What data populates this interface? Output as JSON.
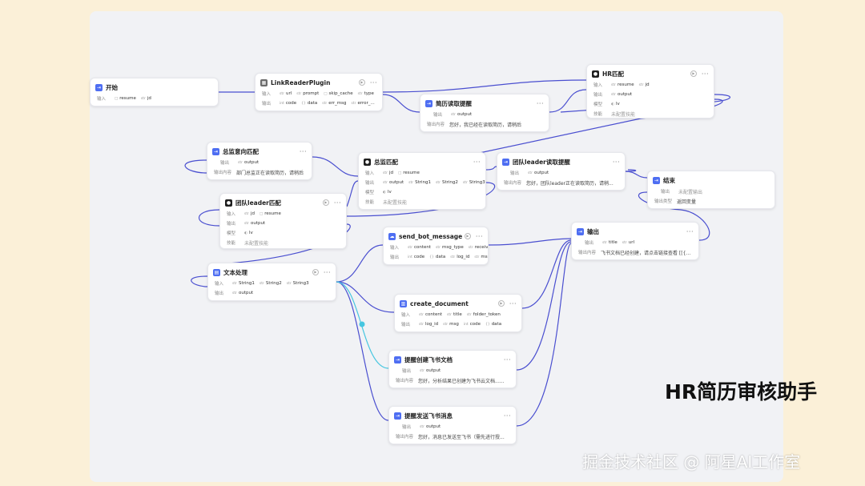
{
  "caption": "HR简历审核助手",
  "watermark": "掘金技术社区 @ 阿星AI工作室",
  "colors": {
    "edge": "#4a4fd0",
    "edge_alt": "#46c6e0",
    "accent": "#4e6ef2"
  },
  "nodes": {
    "start": {
      "title": "开始",
      "in_label": "输入",
      "params": [
        "resume",
        "jd"
      ]
    },
    "link_reader": {
      "title": "LinkReaderPlugin",
      "in_label": "输入",
      "in_params": [
        "url",
        "prompt",
        "skip_cache",
        "type"
      ],
      "out_label": "输出",
      "out_params": [
        "code",
        "data",
        "err_msg",
        "error_..."
      ]
    },
    "resume_reading": {
      "title": "简历读取提醒",
      "out_label": "输出",
      "out_params": [
        "output"
      ],
      "content_label": "输出内容",
      "content": "您好，我已经在读取简历，请稍后"
    },
    "hr_match": {
      "title": "HR匹配",
      "in_label": "输入",
      "in_params": [
        "resume",
        "jd"
      ],
      "out_label": "输出",
      "out_params": [
        "output"
      ],
      "model_label": "模型",
      "model": "lv",
      "skill_label": "技能",
      "skill": "未配置技能"
    },
    "director_intent": {
      "title": "总监意向匹配",
      "out_label": "输出",
      "out_params": [
        "output"
      ],
      "content_label": "输出内容",
      "content": "部门总监正在读取简历，请稍后"
    },
    "director_match": {
      "title": "总监匹配",
      "in_label": "输入",
      "in_params": [
        "jd",
        "resume"
      ],
      "out_label": "输出",
      "out_params": [
        "output",
        "String1",
        "String2",
        "String3"
      ],
      "model_label": "模型",
      "model": "lv",
      "skill_label": "技能",
      "skill": "未配置技能"
    },
    "team_leader_reading": {
      "title": "团队leader读取提醒",
      "out_label": "输出",
      "out_params": [
        "output"
      ],
      "content_label": "输出内容",
      "content": "您好，团队leader正在读取简历，请稍..."
    },
    "end": {
      "title": "结束",
      "out_label": "输出",
      "out_value": "未配置输出",
      "type_label": "输出类型",
      "type_value": "返回变量"
    },
    "team_leader_match": {
      "title": "团队leader匹配",
      "in_label": "输入",
      "in_params": [
        "jd",
        "resume"
      ],
      "out_label": "输出",
      "out_params": [
        "output"
      ],
      "model_label": "模型",
      "model": "lv",
      "skill_label": "技能",
      "skill": "未配置技能"
    },
    "send_bot": {
      "title": "send_bot_message",
      "in_label": "输入",
      "in_params": [
        "content",
        "msg_type",
        "receive_id"
      ],
      "out_label": "输出",
      "out_params": [
        "code",
        "data",
        "log_id",
        "msg"
      ]
    },
    "output": {
      "title": "输出",
      "out_label": "输出",
      "out_params": [
        "title",
        "url"
      ],
      "content_label": "输出内容",
      "content": "飞书文档已经创建，请点击链接查看 [[{h..."
    },
    "text_process": {
      "title": "文本处理",
      "in_label": "输入",
      "in_params": [
        "String1",
        "String2",
        "String3"
      ],
      "out_label": "输出",
      "out_params": [
        "output"
      ]
    },
    "create_doc": {
      "title": "create_document",
      "in_label": "输入",
      "in_params": [
        "content",
        "title",
        "folder_token"
      ],
      "out_label": "输出",
      "out_params": [
        "log_id",
        "msg",
        "code",
        "data"
      ]
    },
    "remind_doc": {
      "title": "提醒创建飞书文档",
      "out_label": "输出",
      "out_params": [
        "output"
      ],
      "content_label": "输出内容",
      "content": "您好，分析结果已创建为飞书云文档......"
    },
    "remind_msg": {
      "title": "提醒发送飞书消息",
      "out_label": "输出",
      "out_params": [
        "output"
      ],
      "content_label": "输出内容",
      "content": "您好，消息已发送至飞书（需先进行授..."
    }
  }
}
